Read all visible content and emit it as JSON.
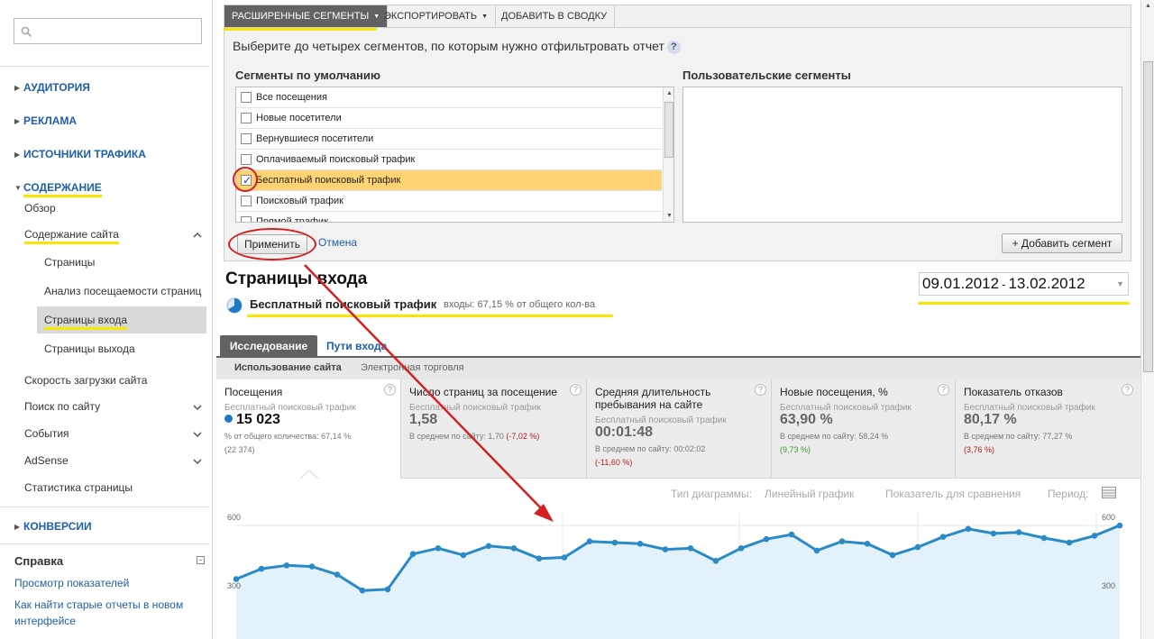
{
  "sidebar": {
    "search": {
      "placeholder": ""
    },
    "sections": {
      "audience": "АУДИТОРИЯ",
      "ads": "РЕКЛАМА",
      "traffic": "ИСТОЧНИКИ ТРАФИКА",
      "content": "СОДЕРЖАНИЕ",
      "conversions": "КОНВЕРСИИ"
    },
    "content_items": {
      "overview": "Обзор",
      "site_content": "Содержание сайта",
      "pages": "Страницы",
      "page_analytics": "Анализ посещаемости страниц",
      "landing_pages": "Страницы входа",
      "exit_pages": "Страницы выхода",
      "site_speed": "Скорость загрузки сайта",
      "site_search": "Поиск по сайту",
      "events": "События",
      "adsense": "AdSense",
      "page_stats": "Статистика страницы"
    },
    "help": {
      "title": "Справка",
      "links": [
        "Просмотр показателей",
        "Как найти старые отчеты в новом интерфейсе"
      ]
    }
  },
  "toolbar": {
    "advanced_segments": "РАСШИРЕННЫЕ СЕГМЕНТЫ",
    "export": "ЭКСПОРТИРОВАТЬ",
    "add_to_dashboard": "ДОБАВИТЬ В СВОДКУ"
  },
  "segments": {
    "prompt": "Выберите до четырех сегментов, по которым нужно отфильтровать отчет",
    "default_header": "Сегменты по умолчанию",
    "custom_header": "Пользовательские сегменты",
    "default_items": [
      {
        "label": "Все посещения",
        "checked": false
      },
      {
        "label": "Новые посетители",
        "checked": false
      },
      {
        "label": "Вернувшиеся посетители",
        "checked": false
      },
      {
        "label": "Оплачиваемый поисковый трафик",
        "checked": false
      },
      {
        "label": "Бесплатный поисковый трафик",
        "checked": true
      },
      {
        "label": "Поисковый трафик",
        "checked": false
      },
      {
        "label": "Прямой трафик",
        "checked": false
      }
    ],
    "apply": "Применить",
    "cancel": "Отмена",
    "add_segment": "+ Добавить сегмент"
  },
  "report": {
    "title": "Страницы входа",
    "segment_name": "Бесплатный поисковый трафик",
    "segment_detail": "входы: 67,15 % от общего кол-ва",
    "date_from": "09.01.2012",
    "date_sep": "-",
    "date_to": "13.02.2012"
  },
  "tabs": {
    "explore": "Исследование",
    "paths": "Пути входа",
    "site_usage": "Использование сайта",
    "ecommerce": "Электронная торговля"
  },
  "metrics": [
    {
      "title": "Посещения",
      "segment": "Бесплатный поисковый трафик",
      "value": "15 023",
      "note1": "% от общего количества: 67,14 %",
      "note2": "(22 374)",
      "delta": ""
    },
    {
      "title": "Число страниц за посещение",
      "segment": "Бесплатный поисковый трафик",
      "value": "1,58",
      "note1": "В среднем по сайту: 1,70",
      "note2": "",
      "delta": "(-7,02 %)"
    },
    {
      "title": "Средняя длительность пребывания на сайте",
      "segment": "Бесплатный поисковый трафик",
      "value": "00:01:48",
      "note1": "В среднем по сайту: 00:02:02",
      "note2": "",
      "delta": "(-11,60 %)"
    },
    {
      "title": "Новые посещения, %",
      "segment": "Бесплатный поисковый трафик",
      "value": "63,90 %",
      "note1": "В среднем по сайту: 58,24 %",
      "note2": "",
      "delta": "(9,73 %)"
    },
    {
      "title": "Показатель отказов",
      "segment": "Бесплатный поисковый трафик",
      "value": "80,17 %",
      "note1": "В среднем по сайту: 77,27 %",
      "note2": "",
      "delta": "(3,76 %)"
    }
  ],
  "chart_controls": {
    "chart_type_label": "Тип диаграммы:",
    "chart_type_value": "Линейный график",
    "compare": "Показатель для сравнения",
    "period": "Период:"
  },
  "colors": {
    "accent_blue": "#1f78c8",
    "line": "#2a8ac8",
    "fill": "#e3f1fa",
    "highlight_yellow": "#f6e800",
    "annotation_red": "#d42020",
    "selected_row": "#ffd272"
  },
  "chart_data": {
    "type": "area",
    "y_ticks_left": [
      "600",
      "300"
    ],
    "y_ticks_right": [
      "600",
      "300"
    ],
    "ylim": [
      0,
      600
    ],
    "x": [
      1,
      2,
      3,
      4,
      5,
      6,
      7,
      8,
      9,
      10,
      11,
      12,
      13,
      14,
      15,
      16,
      17,
      18,
      19,
      20,
      21,
      22,
      23,
      24,
      25,
      26,
      27,
      28,
      29,
      30,
      31,
      32,
      33,
      34,
      35,
      36
    ],
    "series": [
      {
        "values": [
          365,
          410,
          425,
          420,
          385,
          315,
          320,
          475,
          500,
          470,
          510,
          500,
          455,
          460,
          530,
          525,
          520,
          495,
          500,
          445,
          500,
          540,
          560,
          490,
          530,
          520,
          470,
          505,
          550,
          585,
          565,
          570,
          545,
          525,
          555,
          600
        ]
      }
    ]
  }
}
